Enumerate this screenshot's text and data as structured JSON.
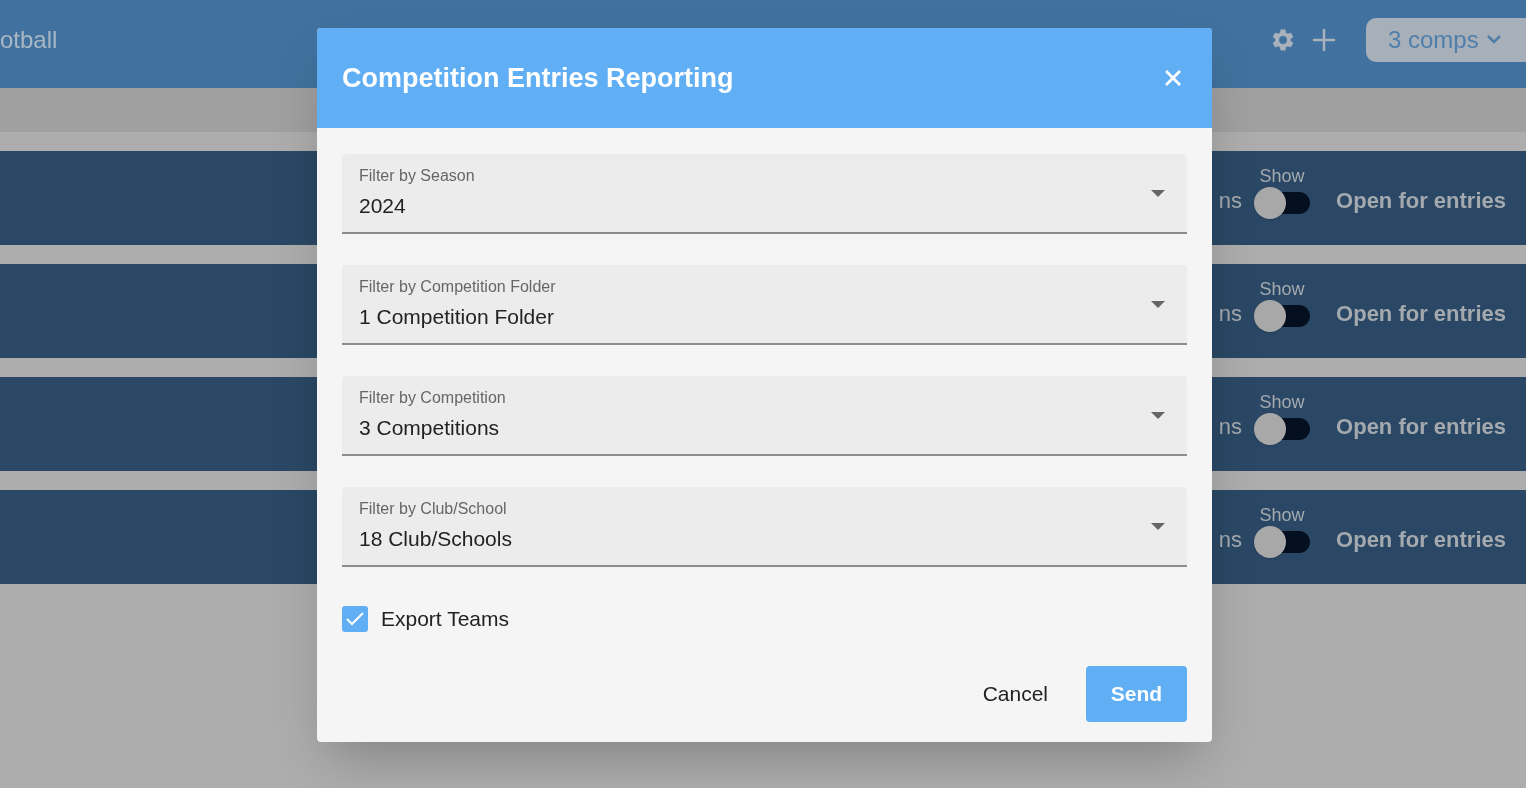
{
  "header": {
    "title": "otball",
    "comps_button": "3 comps"
  },
  "rows": [
    {
      "text_fragment": "ns",
      "toggle_label": "Show",
      "on": false,
      "status": "Open for entries"
    },
    {
      "text_fragment": "ns",
      "toggle_label": "Show",
      "on": false,
      "status": "Open for entries"
    },
    {
      "text_fragment": "ns",
      "toggle_label": "Show",
      "on": false,
      "status": "Open for entries"
    },
    {
      "text_fragment": "ns",
      "toggle_label": "Show",
      "on": false,
      "status": "Open for entries"
    }
  ],
  "dialog": {
    "title": "Competition Entries Reporting",
    "fields": [
      {
        "label": "Filter by Season",
        "value": "2024"
      },
      {
        "label": "Filter by Competition Folder",
        "value": "1 Competition Folder"
      },
      {
        "label": "Filter by Competition",
        "value": "3 Competitions"
      },
      {
        "label": "Filter by Club/School",
        "value": "18 Club/Schools"
      }
    ],
    "checkbox": {
      "label": "Export Teams",
      "checked": true
    },
    "buttons": [
      {
        "label": "Cancel",
        "kind": "text"
      },
      {
        "label": "Send",
        "kind": "primary"
      }
    ]
  }
}
